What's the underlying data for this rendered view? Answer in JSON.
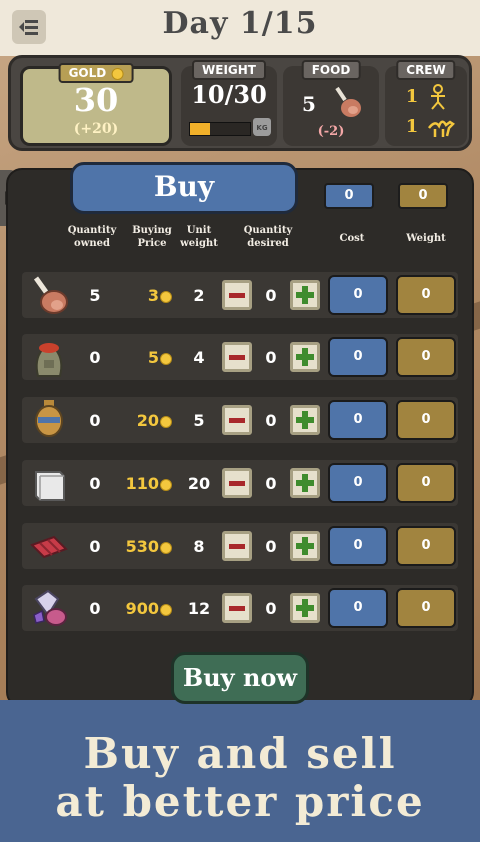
{
  "header": {
    "title": "Day 1/15"
  },
  "stats": {
    "gold": {
      "label": "GOLD",
      "value": "30",
      "delta": "(+20)"
    },
    "weight": {
      "label": "WEIGHT",
      "value": "10/30",
      "unit": "KG",
      "fill_fraction": 0.33
    },
    "food": {
      "label": "FOOD",
      "value": "5",
      "delta": "(-2)"
    },
    "crew": {
      "label": "CREW",
      "people": "1",
      "camels": "1"
    }
  },
  "panel": {
    "title": "Buy",
    "total_cost": "0",
    "total_weight": "0",
    "headers": {
      "owned": "Quantity owned",
      "price": "Buying Price",
      "unit_weight": "Unit weight",
      "desired": "Quantity desired",
      "cost": "Cost",
      "weight": "Weight"
    },
    "items": [
      {
        "icon": "meat-icon",
        "owned": "5",
        "price": "3",
        "weight": "2",
        "desired": "0",
        "cost": "0",
        "total_weight": "0"
      },
      {
        "icon": "spice-sack-icon",
        "owned": "0",
        "price": "5",
        "weight": "4",
        "desired": "0",
        "cost": "0",
        "total_weight": "0"
      },
      {
        "icon": "amphora-icon",
        "owned": "0",
        "price": "20",
        "weight": "5",
        "desired": "0",
        "cost": "0",
        "total_weight": "0"
      },
      {
        "icon": "salt-block-icon",
        "owned": "0",
        "price": "110",
        "weight": "20",
        "desired": "0",
        "cost": "0",
        "total_weight": "0"
      },
      {
        "icon": "silk-roll-icon",
        "owned": "0",
        "price": "530",
        "weight": "8",
        "desired": "0",
        "cost": "0",
        "total_weight": "0"
      },
      {
        "icon": "gems-icon",
        "owned": "0",
        "price": "900",
        "weight": "12",
        "desired": "0",
        "cost": "0",
        "total_weight": "0"
      }
    ],
    "buy_now": "Buy now"
  },
  "banner": {
    "line1": "Buy and sell",
    "line2": "at better price"
  },
  "colors": {
    "blue": "#4f74a9",
    "olive": "#a1843f",
    "gold_text": "#f3c73e",
    "green": "#3f6d55"
  }
}
